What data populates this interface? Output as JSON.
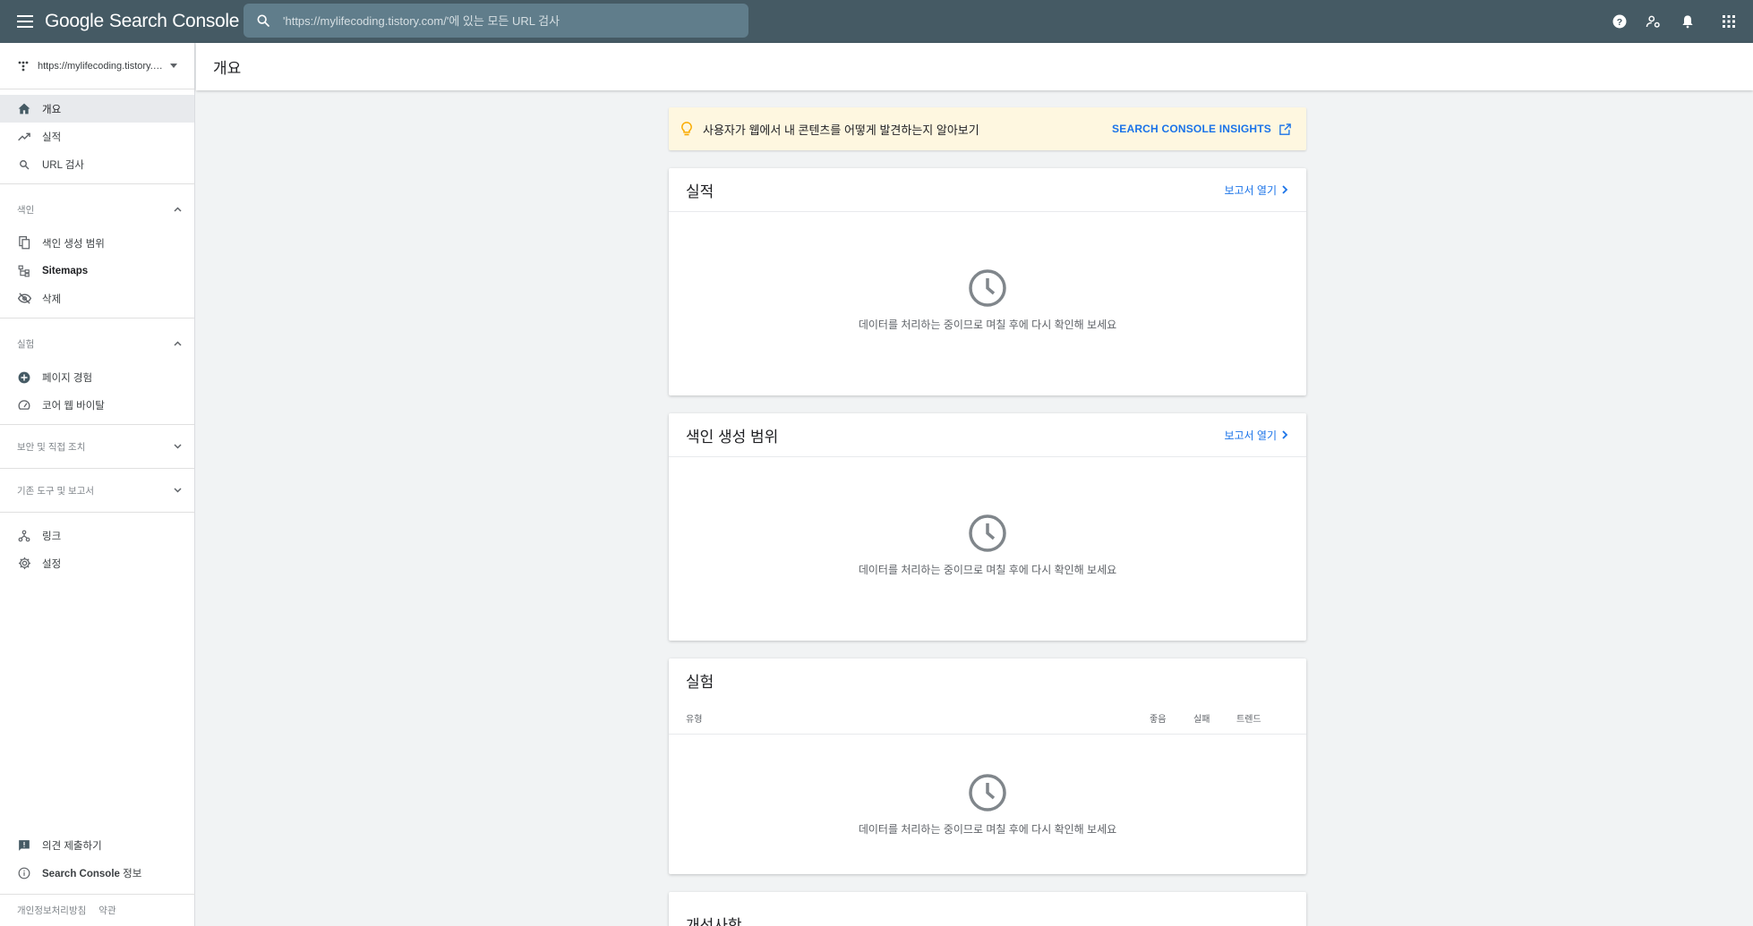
{
  "app": {
    "brand_google": "Google",
    "brand_product": "Search Console"
  },
  "search": {
    "placeholder": "'https://mylifecoding.tistory.com/'에 있는 모든 URL 검사"
  },
  "property": {
    "url": "https://mylifecoding.tistory.c..."
  },
  "sidebar": {
    "nav": [
      {
        "label": "개요",
        "icon": "home-icon"
      },
      {
        "label": "실적",
        "icon": "trending-up-icon"
      },
      {
        "label": "URL 검사",
        "icon": "search-icon"
      }
    ],
    "index_section": {
      "label": "색인"
    },
    "index_items": [
      {
        "label": "색인 생성 범위",
        "icon": "file-copy-icon"
      },
      {
        "label": "Sitemaps",
        "icon": "sitemap-icon"
      },
      {
        "label": "삭제",
        "icon": "visibility-off-icon"
      }
    ],
    "experience_section": {
      "label": "실험"
    },
    "experience_items": [
      {
        "label": "페이지 경험",
        "icon": "add-circle-icon"
      },
      {
        "label": "코어 웹 바이탈",
        "icon": "speed-icon"
      }
    ],
    "security_section": {
      "label": "보안 및 직접 조치"
    },
    "legacy_section": {
      "label": "기존 도구 및 보고서"
    },
    "misc_items": [
      {
        "label": "링크",
        "icon": "links-icon"
      },
      {
        "label": "설정",
        "icon": "settings-icon"
      }
    ],
    "bottom_items": [
      {
        "label": "의견 제출하기",
        "icon": "feedback-icon"
      },
      {
        "label_bold": "Search Console",
        "label_rest": " 정보",
        "icon": "info-icon"
      }
    ],
    "footer": {
      "privacy": "개인정보처리방침",
      "terms": "약관"
    }
  },
  "page": {
    "title": "개요"
  },
  "insights": {
    "message": "사용자가 웹에서 내 콘텐츠를 어떻게 발견하는지 알아보기",
    "link": "SEARCH CONSOLE INSIGHTS"
  },
  "cards": {
    "performance": {
      "title": "실적",
      "link": "보고서 열기",
      "pending": "데이터를 처리하는 중이므로 며칠 후에 다시 확인해 보세요"
    },
    "coverage": {
      "title": "색인 생성 범위",
      "link": "보고서 열기",
      "pending": "데이터를 처리하는 중이므로 며칠 후에 다시 확인해 보세요"
    },
    "experience": {
      "title": "실험",
      "columns": {
        "type": "유형",
        "good": "좋음",
        "fail": "실패",
        "trend": "트렌드"
      },
      "pending": "데이터를 처리하는 중이므로 며칠 후에 다시 확인해 보세요"
    },
    "enhancements": {
      "title": "개선사항"
    }
  },
  "colors": {
    "topbar": "#455a64",
    "search": "#607d8b",
    "link": "#1a73e8",
    "insight_bg": "#fef7e0",
    "bulb": "#f9ab00"
  }
}
